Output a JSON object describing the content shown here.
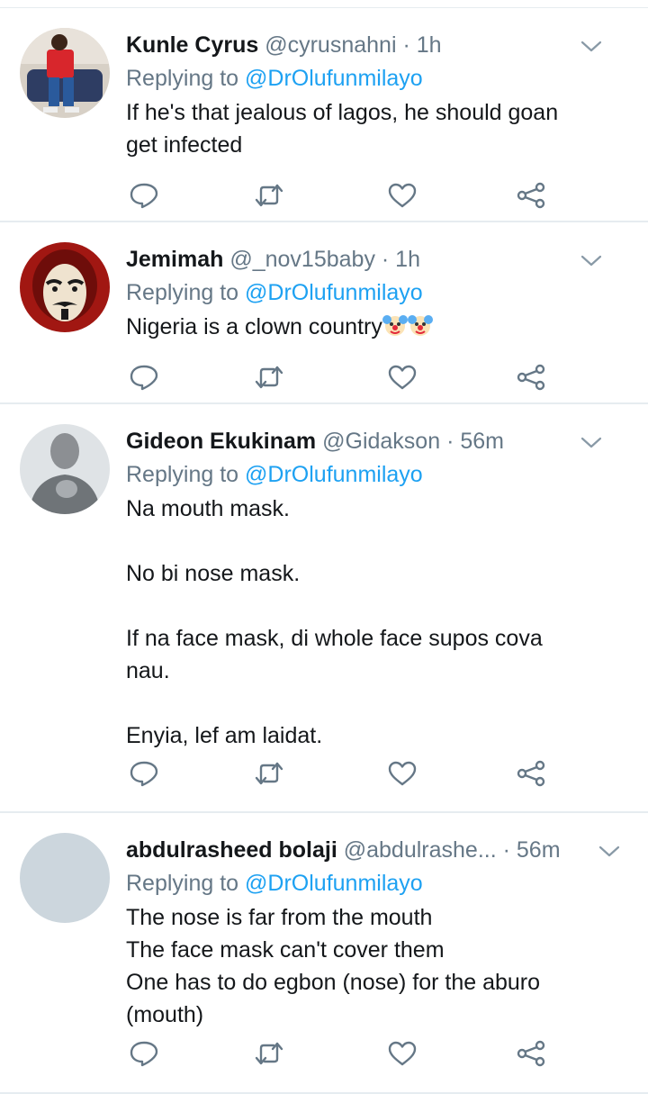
{
  "tweets": [
    {
      "name": "Kunle Cyrus",
      "handle": "@cyrusnahni",
      "time": "· 1h",
      "replying_prefix": "Replying to",
      "replying_to": "@DrOlufunmilayo",
      "lines": [
        "If he's that jealous of lagos, he should goan",
        "get infected"
      ]
    },
    {
      "name": "Jemimah",
      "handle": "@_nov15baby",
      "time": "· 1h",
      "replying_prefix": "Replying to",
      "replying_to": "@DrOlufunmilayo",
      "text": "Nigeria is a clown country",
      "emoji": [
        "clown-face",
        "clown-face"
      ]
    },
    {
      "name": "Gideon Ekukinam",
      "handle": "@Gidakson",
      "time": "· 56m",
      "replying_prefix": "Replying to",
      "replying_to": "@DrOlufunmilayo",
      "lines": [
        "Na mouth mask.",
        "",
        "No bi nose mask.",
        "",
        "If na face mask, di whole face supos cova",
        "nau.",
        "",
        "Enyia, lef am laidat."
      ]
    },
    {
      "name": "abdulrasheed bolaji",
      "handle": "@abdulrashe...",
      "time": "· 56m",
      "replying_prefix": "Replying to",
      "replying_to": "@DrOlufunmilayo",
      "lines": [
        "The nose is far from the mouth",
        "The face mask can't cover them",
        "One has to do egbon (nose) for the aburo",
        "(mouth)"
      ]
    }
  ],
  "icons": [
    "reply-icon",
    "retweet-icon",
    "like-icon",
    "share-icon",
    "chevron-down-icon"
  ],
  "colors": {
    "text": "#14171a",
    "secondary": "#657786",
    "link": "#1da1f2",
    "divider": "#e6ecf0",
    "icon": "#657786"
  }
}
